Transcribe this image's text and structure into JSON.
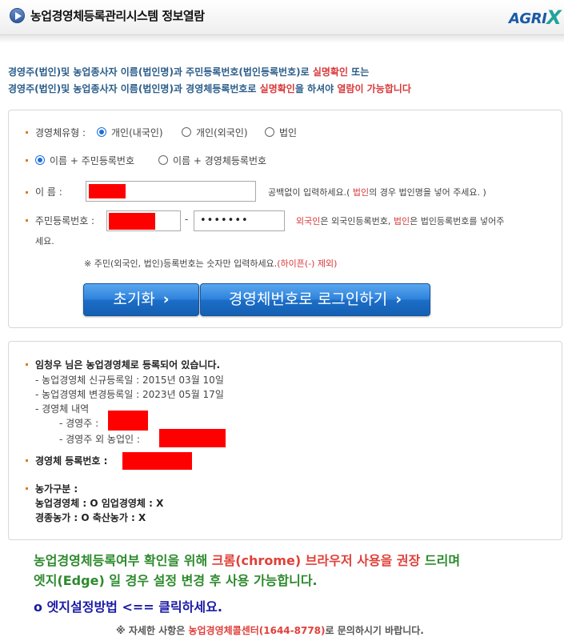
{
  "header": {
    "title": "농업경영체등록관리시스템 정보열람",
    "logo_part1": "AGRI",
    "logo_part2": "X"
  },
  "intro": {
    "line1_a": "경영주(법인)및 농업종사자 이름(법인명)과 주민등록번호(법인등록번호)로 ",
    "line1_red": "실명확인",
    "line1_b": " 또는",
    "line2_a": "경영주(법인)및 농업종사자 이름(법인명)과 경영체등록번호로 ",
    "line2_red1": "실명확인",
    "line2_b": "을 하셔야 ",
    "line2_red2": "열람이 가능합니다"
  },
  "form": {
    "type_label": "경영체유형 :",
    "type_options": [
      "개인(내국인)",
      "개인(외국인)",
      "법인"
    ],
    "type_selected": "개인(내국인)",
    "method_options": [
      "이름 + 주민등록번호",
      "이름 + 경영체등록번호"
    ],
    "method_selected": "이름 + 주민등록번호",
    "name_label": "이      름 :",
    "name_hint_a": "공백없이 입력하세요.( ",
    "name_hint_red": "법인",
    "name_hint_b": "의 경우 법인명을 넣어 주세요. )",
    "rrn_label": "주민등록번호 :",
    "rrn_dash": "-",
    "rrn_masked": "•••••••",
    "rrn_hint_red1": "외국인",
    "rrn_hint_a": "은 외국인등록번호, ",
    "rrn_hint_red2": "법인",
    "rrn_hint_b": "은 법인등록번호를 넣어주",
    "rrn_hint_c": "세요.",
    "note_a": "※ 주민(외국인, 법인)등록번호는 숫자만 입력하세요.",
    "note_red": "(하이픈(-) 제외)",
    "reset_button": "초기화",
    "login_button": "경영체번호로 로그인하기"
  },
  "result": {
    "headline": "임청우 님은 농업경영체로 등록되어 있습니다.",
    "new_reg": "- 농업경영체 신규등록일 : 2015년 03월 10일",
    "change_reg": "- 농업경영체 변경등록일 : 2023년 05월 17일",
    "details": "- 경영체 내역",
    "owner": "- 경영주 :",
    "other_farmers": "- 경영주 외 농업인 :",
    "reg_number_label": "경영체 등록번호 :",
    "farm_type_label": "농가구분 :",
    "farm_line1": "농업경영체 : O   임업경영체 : X",
    "farm_line2": "경종농가 : O   축산농가 : X"
  },
  "notice": {
    "line1_a": "농업경영체등록여부 확인을 위해 ",
    "line1_red": "크롬(chrome) 브라우저 사용을 권장",
    "line1_b": " 드리며",
    "line2": "엣지(Edge) 일 경우 설정 변경 후 사용 가능합니다.",
    "edge_link": "o 엣지설정방법  <== 클릭하세요."
  },
  "footer": {
    "a": "※ 자세한 사항은 ",
    "red": "농업경영체콜센터(1644-8778)",
    "b": "로 문의하시기 바랍니다."
  },
  "colors": {
    "accent_blue": "#2b5d8a",
    "alert_red": "#d9383a",
    "notice_green": "#2d8a2d",
    "link_navy": "#1a1aa6",
    "bullet_orange": "#e07b22",
    "button_blue": "#1c6ec8",
    "redaction": "#ff0000"
  },
  "icons": [
    "play-arrow-icon",
    "chevron-right-icon",
    "radio-button-icon"
  ]
}
